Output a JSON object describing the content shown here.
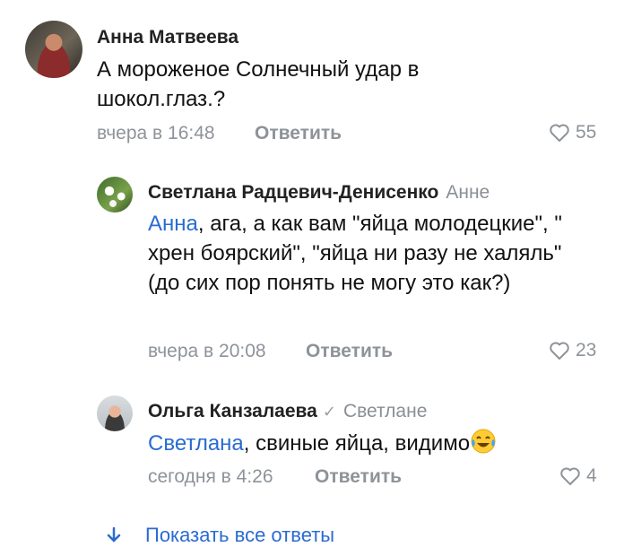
{
  "comments": [
    {
      "author": "Анна Матвеева",
      "text": "А мороженое Солнечный удар в шокол.глаз.?",
      "time": "вчера в 16:48",
      "reply_label": "Ответить",
      "likes": "55"
    },
    {
      "author": "Светлана Радцевич-Денисенко",
      "reply_to": "Анне",
      "mention": "Анна",
      "text": ", ага, а как вам \"яйца молодецкие\", \" хрен боярский\", \"яйца ни разу не халяль\" (до сих пор понять не могу это как?)",
      "time": "вчера в 20:08",
      "reply_label": "Ответить",
      "likes": "23"
    },
    {
      "author": "Ольга Канзалаева",
      "verified_icon": "✓",
      "reply_to": "Светлане",
      "mention": "Светлана",
      "text": ", свиные яйца, видимо",
      "emoji": "tears-of-joy-emoji",
      "time": "сегодня в 4:26",
      "reply_label": "Ответить",
      "likes": "4"
    }
  ],
  "show_all": {
    "icon": "arrow-down-icon",
    "label": "Показать все ответы"
  },
  "colors": {
    "accent": "#2a6bd1",
    "secondary": "#8e9399"
  }
}
